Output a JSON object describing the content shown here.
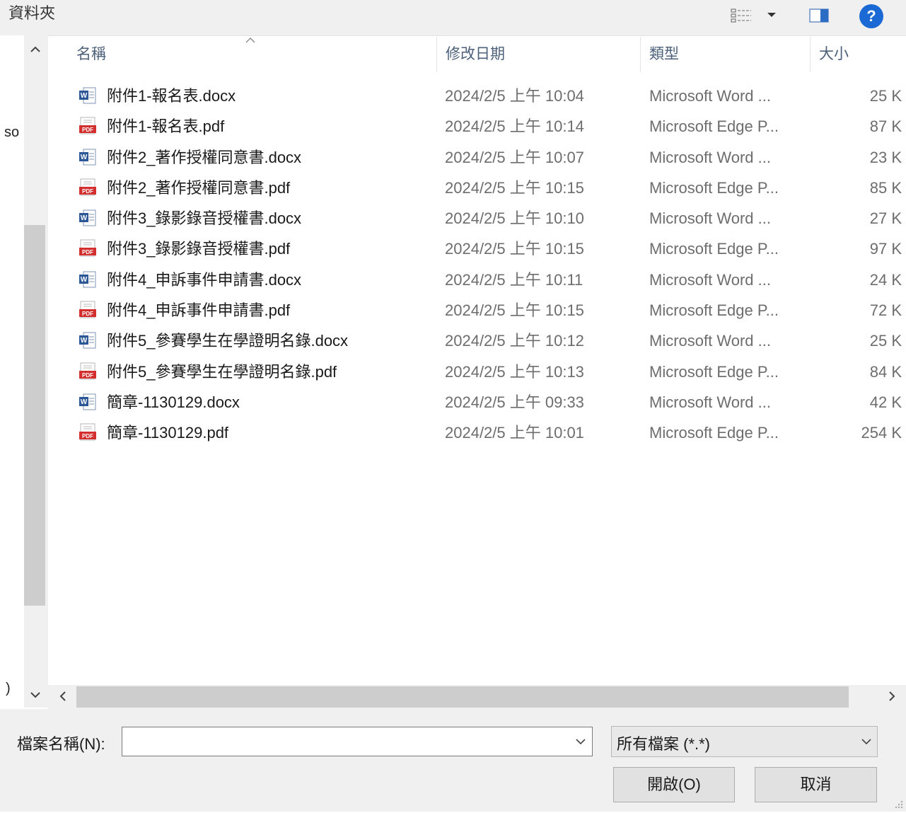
{
  "toolbar": {
    "folder_label": "資料夾",
    "view_icon": "details-view-icon",
    "view_dropdown_icon": "chevron-down-icon",
    "preview_pane_icon": "preview-pane-icon",
    "help_icon": "help-icon",
    "help_glyph": "?"
  },
  "left_edge": {
    "truncated_text_1": "so",
    "truncated_text_2": ")"
  },
  "columns": {
    "name": "名稱",
    "modified": "修改日期",
    "type": "類型",
    "size": "大小",
    "sort_indicator": "sort-ascending-icon"
  },
  "files": [
    {
      "icon": "word",
      "name": "附件1-報名表.docx",
      "date": "2024/2/5 上午 10:04",
      "type": "Microsoft Word ...",
      "size": "25 K"
    },
    {
      "icon": "pdf",
      "name": "附件1-報名表.pdf",
      "date": "2024/2/5 上午 10:14",
      "type": "Microsoft Edge P...",
      "size": "87 K"
    },
    {
      "icon": "word",
      "name": "附件2_著作授權同意書.docx",
      "date": "2024/2/5 上午 10:07",
      "type": "Microsoft Word ...",
      "size": "23 K"
    },
    {
      "icon": "pdf",
      "name": "附件2_著作授權同意書.pdf",
      "date": "2024/2/5 上午 10:15",
      "type": "Microsoft Edge P...",
      "size": "85 K"
    },
    {
      "icon": "word",
      "name": "附件3_錄影錄音授權書.docx",
      "date": "2024/2/5 上午 10:10",
      "type": "Microsoft Word ...",
      "size": "27 K"
    },
    {
      "icon": "pdf",
      "name": "附件3_錄影錄音授權書.pdf",
      "date": "2024/2/5 上午 10:15",
      "type": "Microsoft Edge P...",
      "size": "97 K"
    },
    {
      "icon": "word",
      "name": "附件4_申訴事件申請書.docx",
      "date": "2024/2/5 上午 10:11",
      "type": "Microsoft Word ...",
      "size": "24 K"
    },
    {
      "icon": "pdf",
      "name": "附件4_申訴事件申請書.pdf",
      "date": "2024/2/5 上午 10:15",
      "type": "Microsoft Edge P...",
      "size": "72 K"
    },
    {
      "icon": "word",
      "name": "附件5_參賽學生在學證明名錄.docx",
      "date": "2024/2/5 上午 10:12",
      "type": "Microsoft Word ...",
      "size": "25 K"
    },
    {
      "icon": "pdf",
      "name": "附件5_參賽學生在學證明名錄.pdf",
      "date": "2024/2/5 上午 10:13",
      "type": "Microsoft Edge P...",
      "size": "84 K"
    },
    {
      "icon": "word",
      "name": "簡章-1130129.docx",
      "date": "2024/2/5 上午 09:33",
      "type": "Microsoft Word ...",
      "size": "42 K"
    },
    {
      "icon": "pdf",
      "name": "簡章-1130129.pdf",
      "date": "2024/2/5 上午 10:01",
      "type": "Microsoft Edge P...",
      "size": "254 K"
    }
  ],
  "footer": {
    "filename_label": "檔案名稱(N):",
    "filename_value": "",
    "filetype_value": "所有檔案 (*.*)",
    "open_label": "開啟(O)",
    "cancel_label": "取消"
  },
  "colors": {
    "word_blue": "#2b5797",
    "pdf_red": "#d32f2f",
    "help_blue": "#1b69d4",
    "header_text": "#4c607a"
  }
}
